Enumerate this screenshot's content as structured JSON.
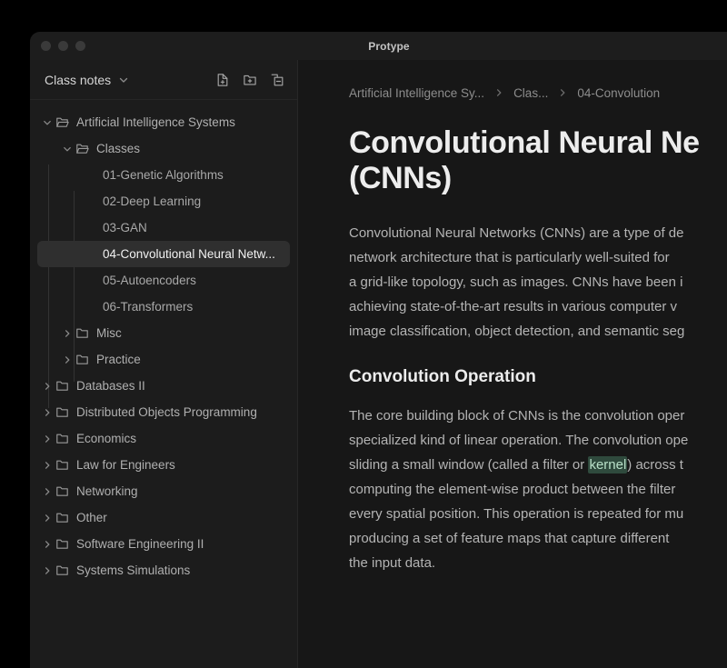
{
  "window": {
    "title": "Protype",
    "traffic_lights": [
      "close-button",
      "minimize-button",
      "zoom-button"
    ]
  },
  "sidebar": {
    "header": {
      "title": "Class notes",
      "caret_icon": "chevron-down-icon",
      "actions": [
        {
          "icon": "new-file-icon",
          "name": "new-note-button"
        },
        {
          "icon": "new-folder-icon",
          "name": "new-folder-button"
        },
        {
          "icon": "collapse-all-icon",
          "name": "collapse-all-button"
        }
      ]
    },
    "tree": [
      {
        "label": "Artificial Intelligence Systems",
        "level": 0,
        "type": "folder",
        "state": "expanded",
        "selected": false
      },
      {
        "label": "Classes",
        "level": 1,
        "type": "folder",
        "state": "expanded",
        "selected": false
      },
      {
        "label": "01-Genetic Algorithms",
        "level": 2,
        "type": "note",
        "state": "none",
        "selected": false
      },
      {
        "label": "02-Deep Learning",
        "level": 2,
        "type": "note",
        "state": "none",
        "selected": false
      },
      {
        "label": "03-GAN",
        "level": 2,
        "type": "note",
        "state": "none",
        "selected": false
      },
      {
        "label": "04-Convolutional Neural Netw...",
        "level": 2,
        "type": "note",
        "state": "none",
        "selected": true
      },
      {
        "label": "05-Autoencoders",
        "level": 2,
        "type": "note",
        "state": "none",
        "selected": false
      },
      {
        "label": "06-Transformers",
        "level": 2,
        "type": "note",
        "state": "none",
        "selected": false
      },
      {
        "label": "Misc",
        "level": 1,
        "type": "folder",
        "state": "collapsed",
        "selected": false
      },
      {
        "label": "Practice",
        "level": 1,
        "type": "folder",
        "state": "collapsed",
        "selected": false
      },
      {
        "label": "Databases II",
        "level": 0,
        "type": "folder",
        "state": "collapsed",
        "selected": false
      },
      {
        "label": "Distributed Objects Programming",
        "level": 0,
        "type": "folder",
        "state": "collapsed",
        "selected": false
      },
      {
        "label": "Economics",
        "level": 0,
        "type": "folder",
        "state": "collapsed",
        "selected": false
      },
      {
        "label": "Law for Engineers",
        "level": 0,
        "type": "folder",
        "state": "collapsed",
        "selected": false
      },
      {
        "label": "Networking",
        "level": 0,
        "type": "folder",
        "state": "collapsed",
        "selected": false
      },
      {
        "label": "Other",
        "level": 0,
        "type": "folder",
        "state": "collapsed",
        "selected": false
      },
      {
        "label": "Software Engineering II",
        "level": 0,
        "type": "folder",
        "state": "collapsed",
        "selected": false
      },
      {
        "label": "Systems Simulations",
        "level": 0,
        "type": "folder",
        "state": "collapsed",
        "selected": false
      }
    ]
  },
  "document": {
    "breadcrumb": [
      "Artificial Intelligence Sy...",
      "Clas...",
      "04-Convolution"
    ],
    "breadcrumb_separator_icon": "chevron-right-icon",
    "title_line1": "Convolutional Neural Ne",
    "title_line2": "(CNNs)",
    "intro": "Convolutional Neural Networks (CNNs) are a type of de\nnetwork architecture that is particularly well-suited for\na grid-like topology, such as images. CNNs have been i\nachieving state-of-the-art results in various computer v\nimage classification, object detection, and semantic seg",
    "section_heading": "Convolution Operation",
    "body_a": "The core building block of CNNs is the convolution oper\nspecialized kind of linear operation. The convolution ope\nsliding a small window (called a filter or ",
    "highlight": "kernel",
    "body_b": ") across t\ncomputing the element-wise product between the filter\nevery spatial position. This operation is repeated for mu\nproducing a set of feature maps that capture different\nthe input data.",
    "highlight_color": "#2f4a3d"
  }
}
